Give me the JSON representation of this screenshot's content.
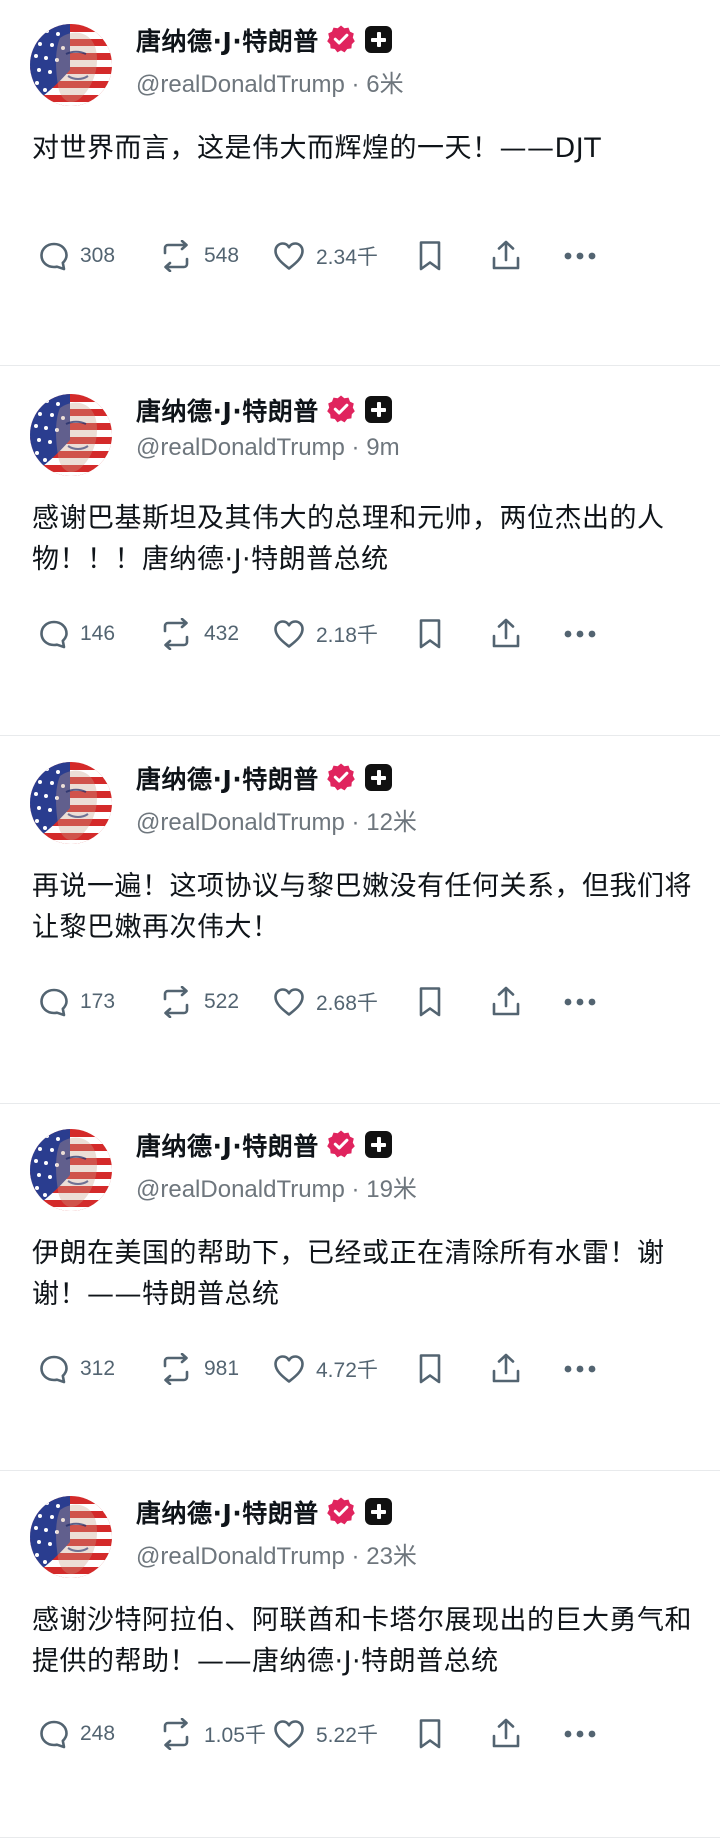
{
  "author": {
    "display_name": "唐纳德·J·特朗普",
    "handle": "@realDonaldTrump",
    "avatar_icon": "avatar-flag-portrait-icon",
    "verified_icon": "verified-badge-icon",
    "affiliate_icon": "plus-badge-icon"
  },
  "colors": {
    "verified": "#e0245e",
    "text_primary": "#0f1419",
    "text_secondary": "#536471",
    "divider": "#e8eaec"
  },
  "posts": [
    {
      "meta": " · 6米",
      "text": "对世界而言，这是伟大而辉煌的一天！——DJT",
      "replies": "308",
      "reposts": "548",
      "likes": "2.34千"
    },
    {
      "meta": " · 9m",
      "text": "感谢巴基斯坦及其伟大的总理和元帅，两位杰出的人物！！！唐纳德·J·特朗普总统",
      "replies": "146",
      "reposts": "432",
      "likes": "2.18千"
    },
    {
      "meta": " · 12米",
      "text": "再说一遍！这项协议与黎巴嫩没有任何关系，但我们将让黎巴嫩再次伟大！",
      "replies": "173",
      "reposts": "522",
      "likes": "2.68千"
    },
    {
      "meta": " · 19米",
      "text": "伊朗在美国的帮助下，已经或正在清除所有水雷！谢谢！——特朗普总统",
      "replies": "312",
      "reposts": "981",
      "likes": "4.72千"
    },
    {
      "meta": " · 23米",
      "text": "感谢沙特阿拉伯、阿联酋和卡塔尔展现出的巨大勇气和提供的帮助！——唐纳德·J·特朗普总统",
      "replies": "248",
      "reposts": "1.05千",
      "likes": "5.22千"
    }
  ]
}
